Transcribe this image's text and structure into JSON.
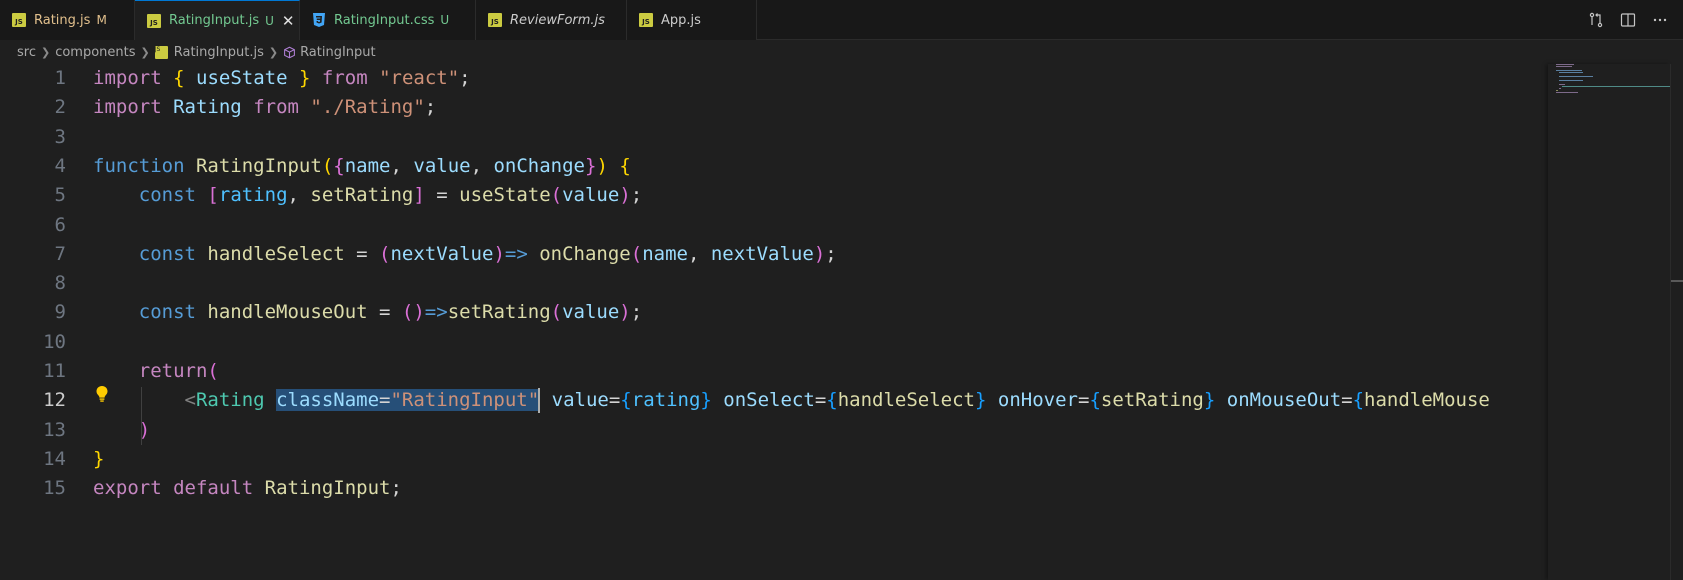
{
  "tabs": [
    {
      "name": "Rating.js",
      "badge": "M",
      "type": "js",
      "color": "#e2c08d",
      "italic": false,
      "active": false
    },
    {
      "name": "RatingInput.js",
      "badge": "U",
      "type": "js",
      "color": "#73c991",
      "italic": false,
      "active": true
    },
    {
      "name": "RatingInput.css",
      "badge": "U",
      "type": "css",
      "color": "#73c991",
      "italic": false,
      "active": false
    },
    {
      "name": "ReviewForm.js",
      "badge": "",
      "type": "js",
      "color": "#cccccc",
      "italic": true,
      "active": false
    },
    {
      "name": "App.js",
      "badge": "",
      "type": "js",
      "color": "#cccccc",
      "italic": false,
      "active": false
    }
  ],
  "file_icon_label": "JS",
  "breadcrumb": {
    "parts": [
      "src",
      "components",
      "RatingInput.js",
      "RatingInput"
    ]
  },
  "editor": {
    "current_line": 12,
    "line_numbers": [
      "1",
      "2",
      "3",
      "4",
      "5",
      "6",
      "7",
      "8",
      "9",
      "10",
      "11",
      "12",
      "13",
      "14",
      "15"
    ]
  },
  "colors": {
    "accent": "#0078d4",
    "modified": "#e2c08d",
    "untracked": "#73c991"
  },
  "icons": {
    "compare": "git-compare-icon",
    "split": "split-editor-icon",
    "more": "more-actions-icon",
    "bulb": "lightbulb-icon"
  }
}
